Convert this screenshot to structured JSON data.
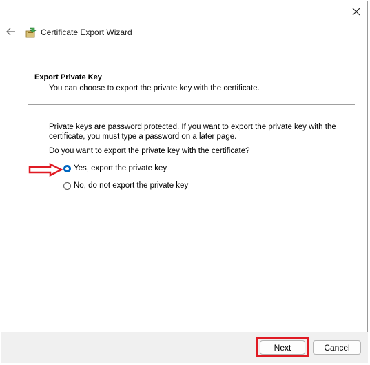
{
  "window": {
    "title": "Certificate Export Wizard"
  },
  "header": {
    "section_title": "Export Private Key",
    "section_description": "You can choose to export the private key with the certificate."
  },
  "content": {
    "info": "Private keys are password protected. If you want to export the private key with the certificate, you must type a password on a later page.",
    "question": "Do you want to export the private key with the certificate?",
    "options": [
      {
        "label": "Yes, export the private key",
        "selected": true
      },
      {
        "label": "No, do not export the private key",
        "selected": false
      }
    ]
  },
  "footer": {
    "next_label": "Next",
    "cancel_label": "Cancel"
  },
  "colors": {
    "accent": "#0067c0",
    "annotation": "#e01b24"
  },
  "icons": {
    "close": "close-icon",
    "back": "back-arrow-icon",
    "app": "certificate-icon"
  }
}
